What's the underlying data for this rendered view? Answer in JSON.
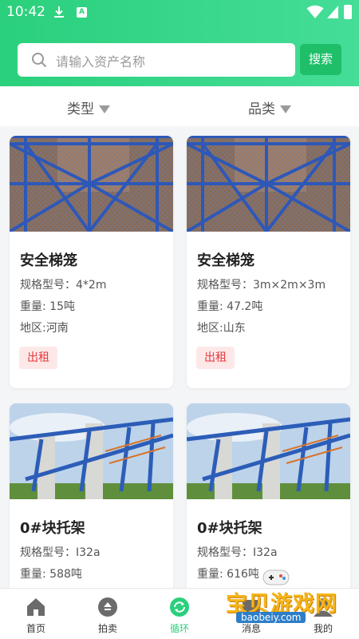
{
  "status_bar": {
    "time": "10:42",
    "app_badge": "A"
  },
  "search": {
    "placeholder": "请输入资产名称",
    "button_label": "搜索"
  },
  "filters": [
    {
      "label": "类型"
    },
    {
      "label": "品类"
    }
  ],
  "cards": [
    {
      "title": "安全梯笼",
      "spec": "规格型号：4*2m",
      "weight": "重量: 15吨",
      "region": "地区:河南",
      "tag": "出租",
      "image": "lift-cage-photo"
    },
    {
      "title": "安全梯笼",
      "spec": "规格型号：3m×2m×3m",
      "weight": "重量: 47.2吨",
      "region": "地区:山东",
      "tag": "出租",
      "image": "lift-cage-photo"
    },
    {
      "title": "0#块托架",
      "spec": "规格型号：I32a",
      "weight": "重量: 588吨",
      "image": "bridge-bracket-photo"
    },
    {
      "title": "0#块托架",
      "spec": "规格型号：I32a",
      "weight": "重量: 616吨",
      "image": "bridge-bracket-photo"
    }
  ],
  "tabbar": [
    {
      "label": "首页",
      "icon": "home-icon"
    },
    {
      "label": "拍卖",
      "icon": "auction-icon"
    },
    {
      "label": "循环",
      "icon": "cycle-icon",
      "active": true
    },
    {
      "label": "消息",
      "icon": "message-icon"
    },
    {
      "label": "我的",
      "icon": "profile-icon"
    }
  ],
  "watermark": {
    "text": "宝贝游戏网",
    "url": "baobeiy.com"
  },
  "colors": {
    "brand_green": "#2ad07c",
    "search_button": "#1fbf6a",
    "tag_red": "#e6393c",
    "tag_bg": "#fde8e8"
  }
}
